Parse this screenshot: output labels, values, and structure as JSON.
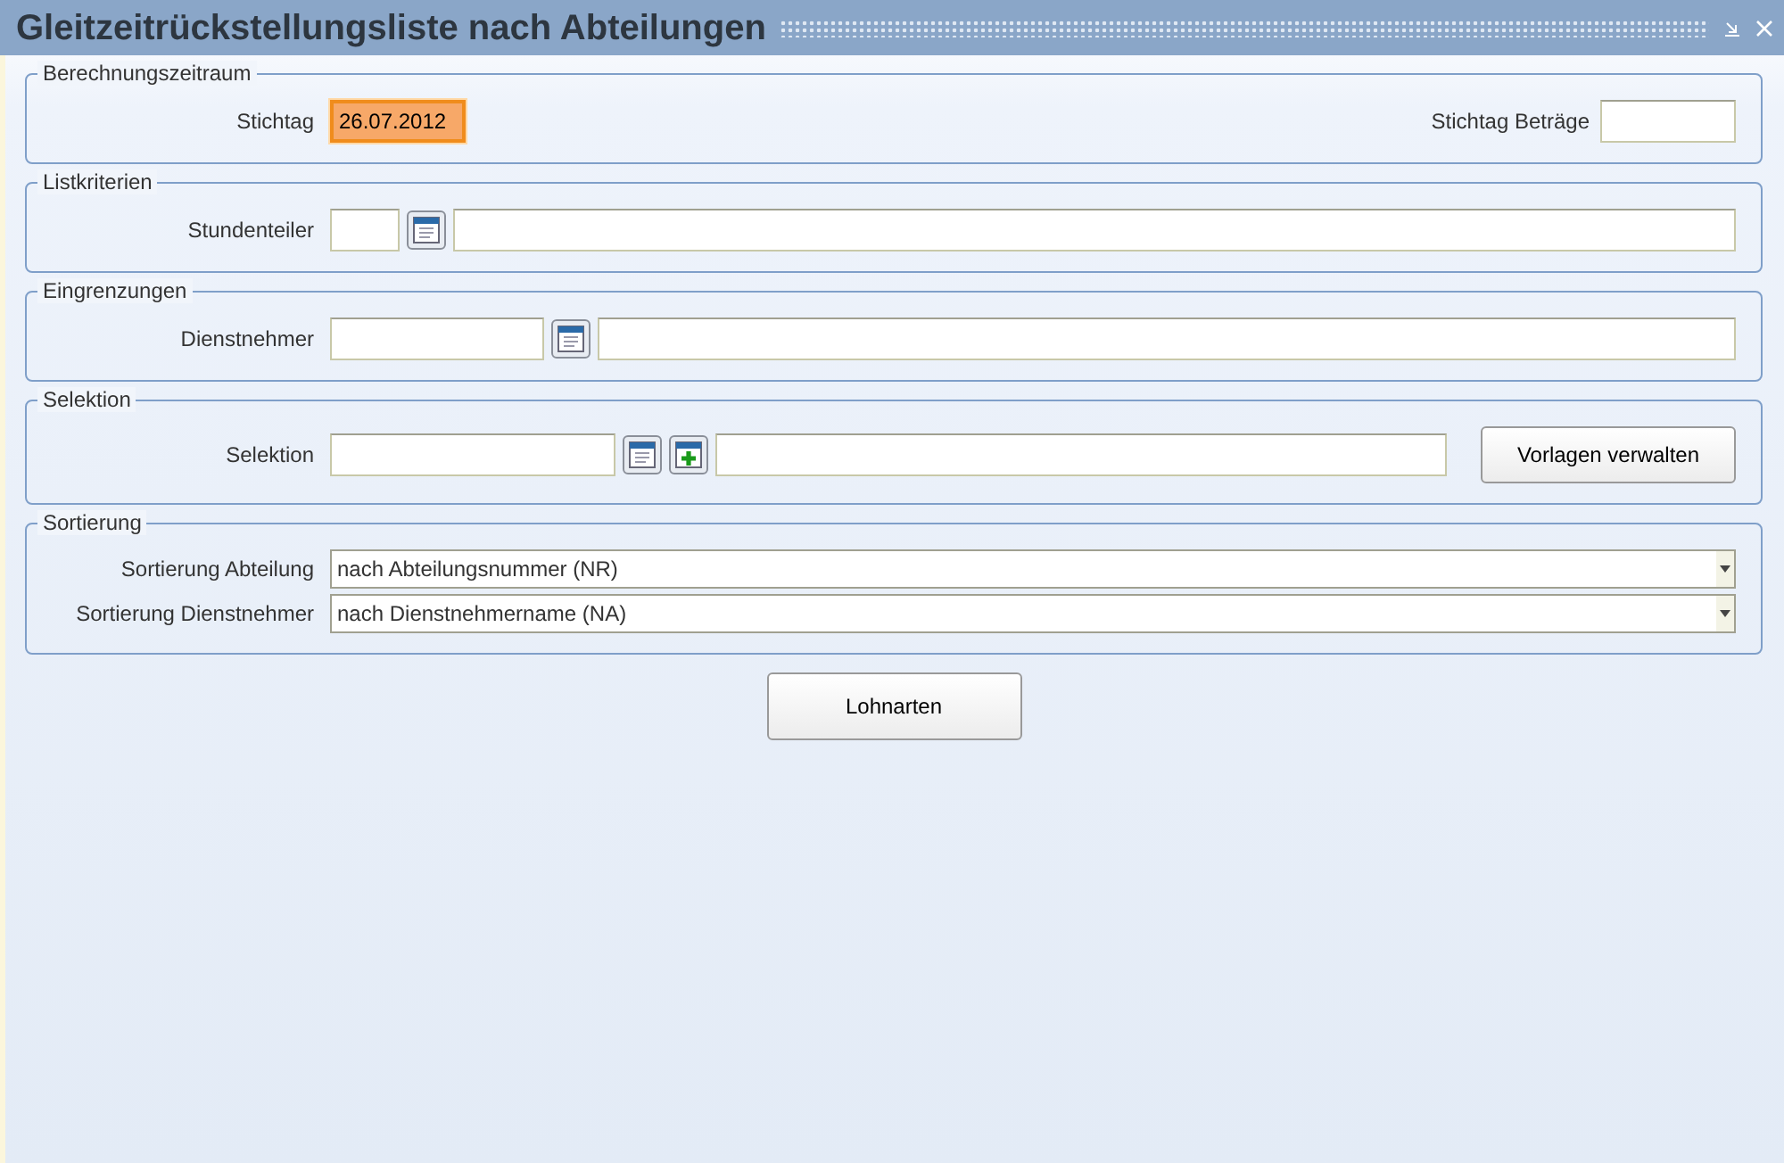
{
  "window": {
    "title": "Gleitzeitrückstellungsliste nach Abteilungen"
  },
  "sections": [
    {
      "legend": "Berechnungszeitraum",
      "rows": [
        {
          "label": "Stichtag",
          "controls": [
            {
              "kind": "datefield",
              "value": "26.07.2012",
              "focused": true
            },
            {
              "kind": "spacer"
            },
            {
              "kind": "label",
              "text": "Stichtag Beträge"
            },
            {
              "kind": "datefield",
              "focused": false
            }
          ]
        }
      ]
    },
    {
      "legend": "Listkriterien",
      "rows": [
        {
          "label": "Stundenteiler",
          "controls": [
            {
              "kind": "tinyfield",
              "focused": false
            },
            {
              "kind": "lookup"
            },
            {
              "kind": "textfield",
              "focused": false
            }
          ]
        }
      ]
    },
    {
      "legend": "Eingrenzungen",
      "rows": [
        {
          "label": "Dienstnehmer",
          "controls": [
            {
              "kind": "codefield",
              "focused": false
            },
            {
              "kind": "lookup"
            },
            {
              "kind": "textfield",
              "focused": false
            }
          ]
        }
      ]
    },
    {
      "legend": "Selektion",
      "rows": [
        {
          "label": "Selektion",
          "controls": [
            {
              "kind": "keyfield",
              "focused": false
            },
            {
              "kind": "lookup"
            },
            {
              "kind": "add"
            },
            {
              "kind": "textfield",
              "focused": false
            },
            {
              "kind": "button",
              "text": "Vorlagen verwalten"
            }
          ]
        }
      ]
    },
    {
      "legend": "Sortierung",
      "rows": [
        {
          "label": "Sortierung Abteilung",
          "controls": [
            {
              "kind": "select",
              "value": "nach Abteilungsnummer (NR)"
            }
          ]
        },
        {
          "label": "Sortierung Dienstnehmer",
          "controls": [
            {
              "kind": "select",
              "value": "nach Dienstnehmername (NA)"
            }
          ]
        }
      ]
    }
  ],
  "footer_button": "Lohnarten"
}
